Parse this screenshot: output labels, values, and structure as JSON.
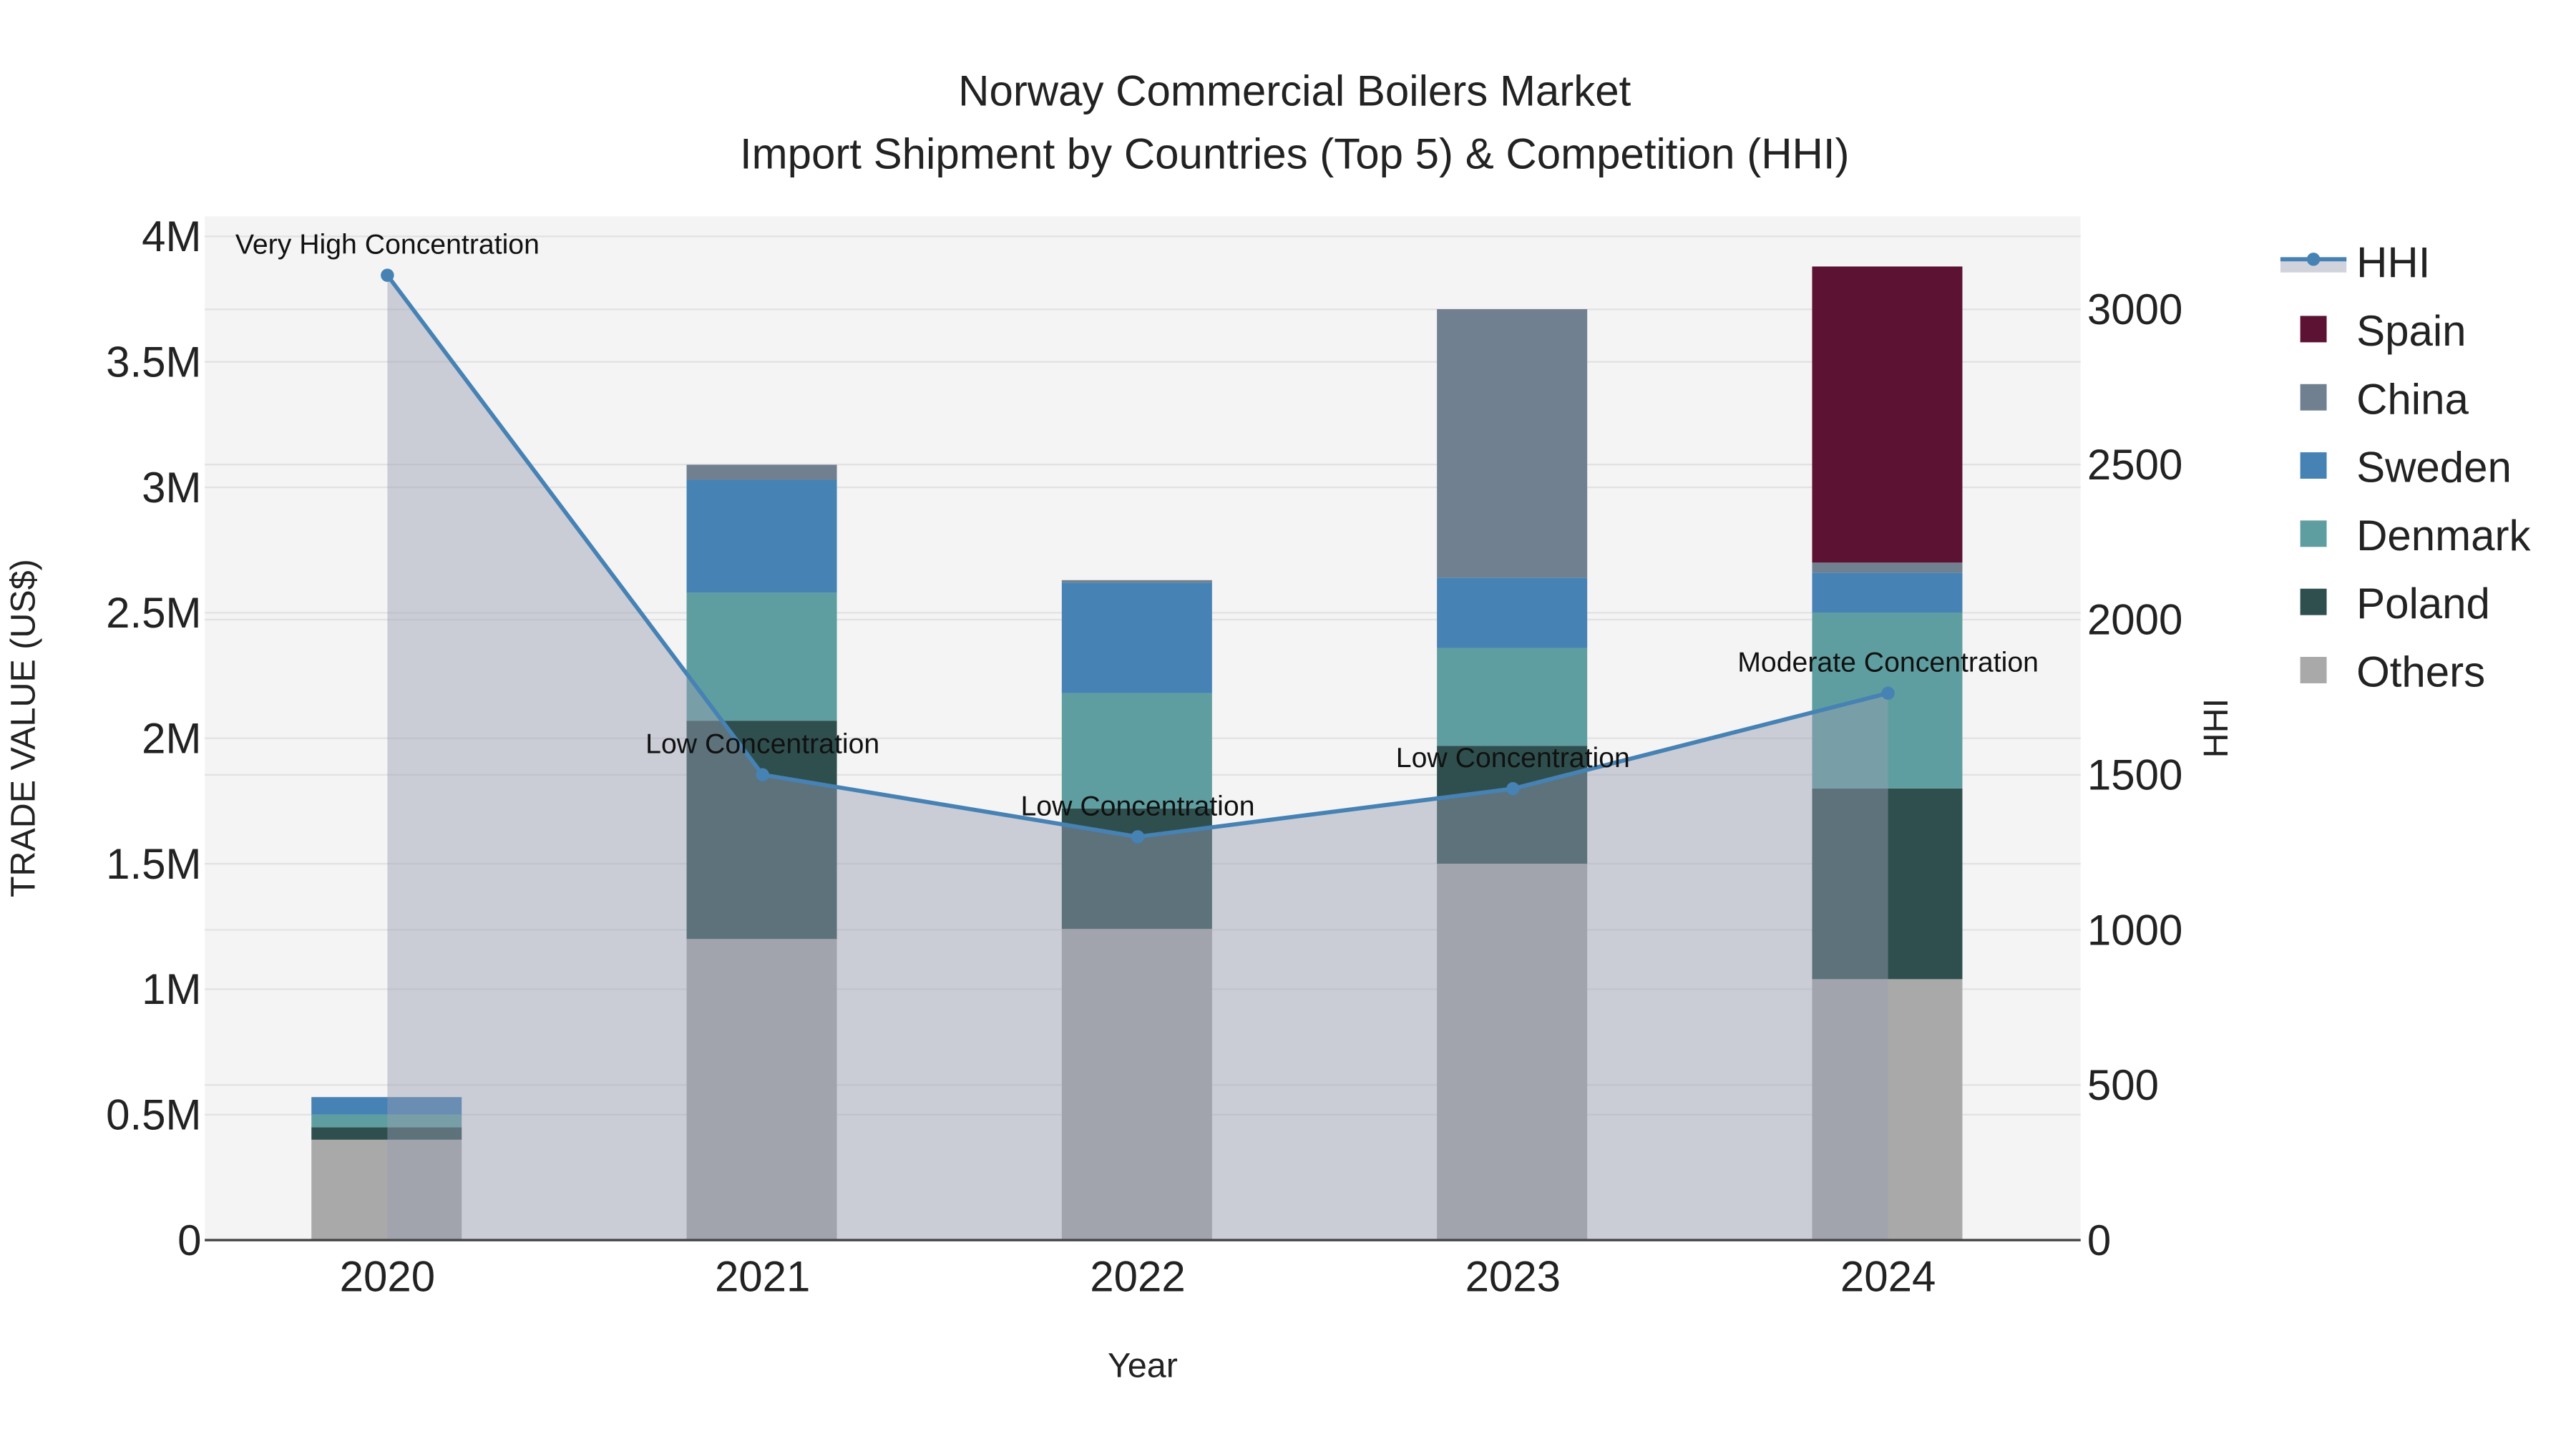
{
  "chart_data": {
    "type": "bar",
    "title": "Norway Commercial Boilers Market",
    "subtitle": "Import Shipment by Countries (Top 5) & Competition (HHI)",
    "xlabel": "Year",
    "ylabel": "TRADE VALUE (US$)",
    "y2label": "HHI",
    "categories": [
      "2020",
      "2021",
      "2022",
      "2023",
      "2024"
    ],
    "ylim": [
      0,
      4080000
    ],
    "y2lim": [
      0,
      3300
    ],
    "yticks": [
      {
        "v": 0,
        "label": "0"
      },
      {
        "v": 500000,
        "label": "0.5M"
      },
      {
        "v": 1000000,
        "label": "1M"
      },
      {
        "v": 1500000,
        "label": "1.5M"
      },
      {
        "v": 2000000,
        "label": "2M"
      },
      {
        "v": 2500000,
        "label": "2.5M"
      },
      {
        "v": 3000000,
        "label": "3M"
      },
      {
        "v": 3500000,
        "label": "3.5M"
      },
      {
        "v": 4000000,
        "label": "4M"
      }
    ],
    "y2ticks": [
      {
        "v": 0,
        "label": "0"
      },
      {
        "v": 500,
        "label": "500"
      },
      {
        "v": 1000,
        "label": "1000"
      },
      {
        "v": 1500,
        "label": "1500"
      },
      {
        "v": 2000,
        "label": "2000"
      },
      {
        "v": 2500,
        "label": "2500"
      },
      {
        "v": 3000,
        "label": "3000"
      }
    ],
    "grid": true,
    "legend_position": "right",
    "series": [
      {
        "name": "Others",
        "color": "#a9a9a9",
        "values": [
          400000,
          1200000,
          1240000,
          1500000,
          1040000
        ]
      },
      {
        "name": "Poland",
        "color": "#2f4f4f",
        "values": [
          50000,
          870000,
          480000,
          470000,
          760000
        ]
      },
      {
        "name": "Denmark",
        "color": "#5f9ea0",
        "values": [
          50000,
          510000,
          460000,
          390000,
          700000
        ]
      },
      {
        "name": "Sweden",
        "color": "#4682b4",
        "values": [
          70000,
          450000,
          440000,
          280000,
          160000
        ]
      },
      {
        "name": "China",
        "color": "#708090",
        "values": [
          0,
          60000,
          10000,
          1070000,
          40000
        ]
      },
      {
        "name": "Spain",
        "color": "#5c1232",
        "values": [
          0,
          0,
          0,
          0,
          1180000
        ]
      }
    ],
    "hhi": {
      "name": "HHI",
      "color": "#4682b4",
      "values": [
        3110,
        1500,
        1300,
        1455,
        1763
      ],
      "annotations": [
        "Very High Concentration",
        "Low Concentration",
        "Low Concentration",
        "Low Concentration",
        "Moderate Concentration"
      ]
    },
    "legend_order": [
      "HHI",
      "Spain",
      "China",
      "Sweden",
      "Denmark",
      "Poland",
      "Others"
    ]
  }
}
